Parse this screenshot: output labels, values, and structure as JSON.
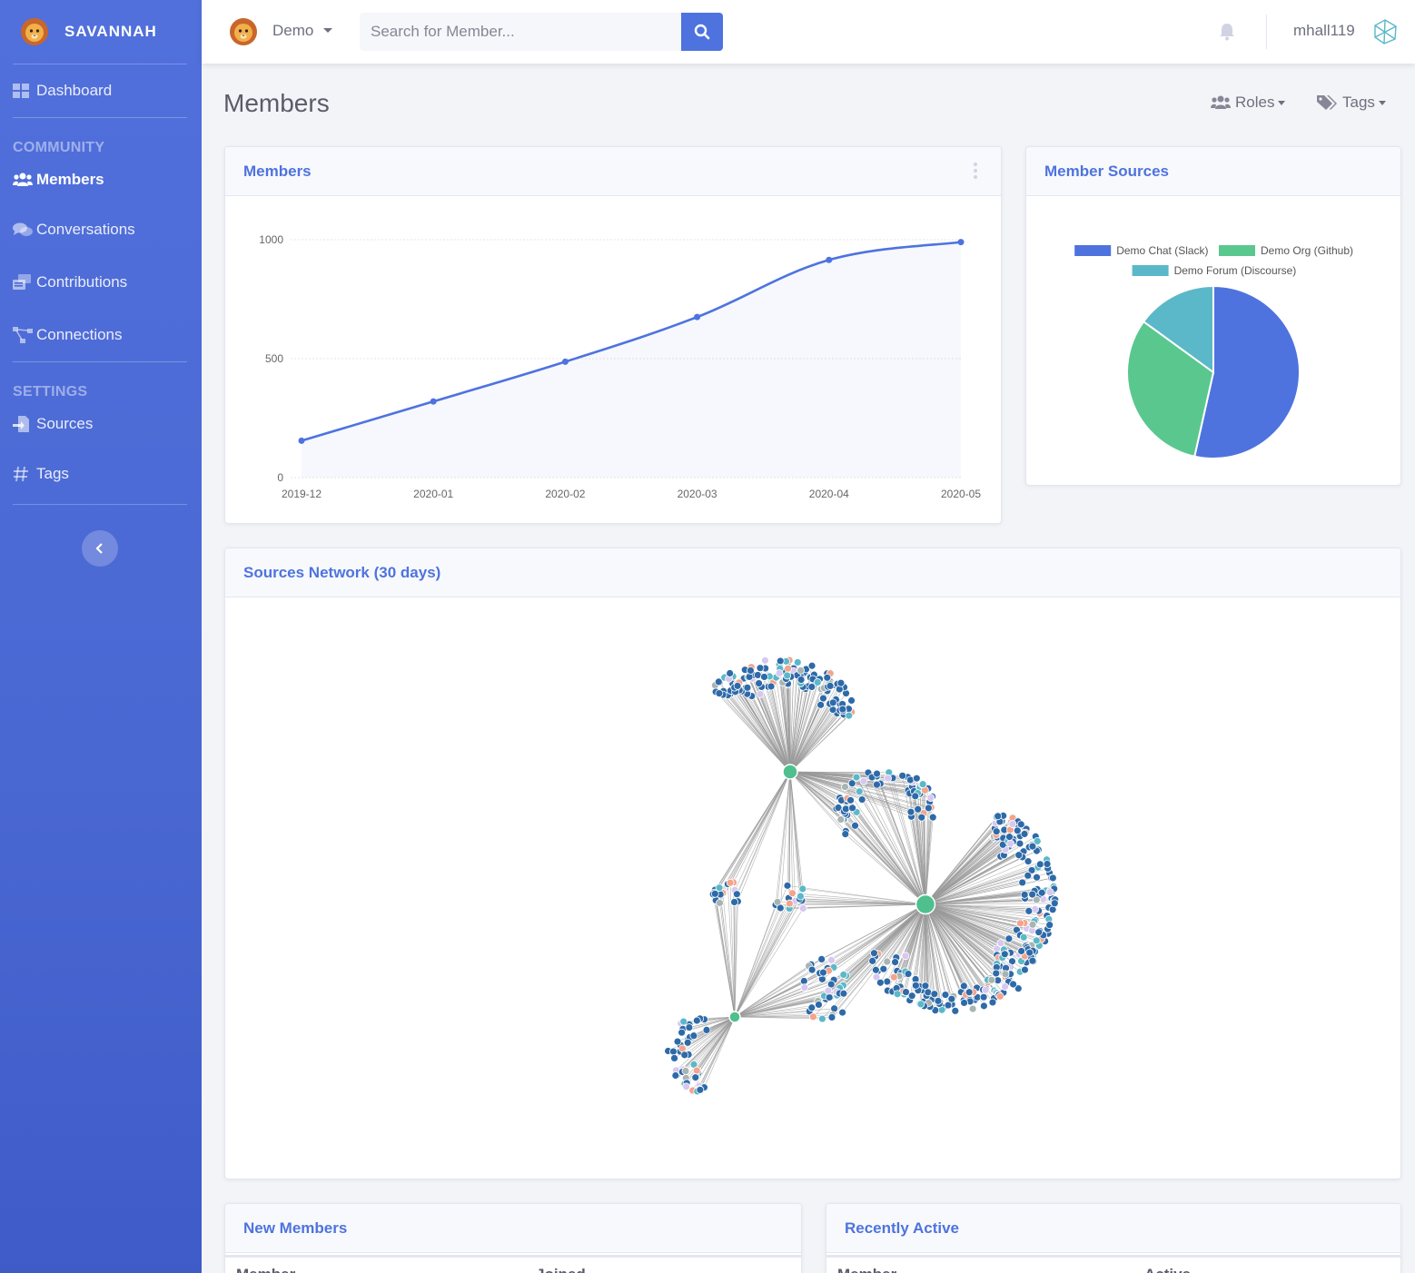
{
  "brand": {
    "name": "SAVANNAH"
  },
  "sidebar": {
    "items": [
      {
        "label": "Dashboard",
        "icon": "dashboard-icon"
      },
      {
        "heading": "COMMUNITY"
      },
      {
        "label": "Members",
        "icon": "users-icon",
        "active": true
      },
      {
        "label": "Conversations",
        "icon": "comments-icon"
      },
      {
        "label": "Contributions",
        "icon": "contributions-icon"
      },
      {
        "label": "Connections",
        "icon": "connections-icon"
      },
      {
        "heading": "SETTINGS"
      },
      {
        "label": "Sources",
        "icon": "sources-icon"
      },
      {
        "label": "Tags",
        "icon": "hash-icon"
      }
    ]
  },
  "topbar": {
    "org": "Demo",
    "search_placeholder": "Search for Member...",
    "username": "mhall119"
  },
  "page": {
    "title": "Members",
    "roles_label": "Roles",
    "tags_label": "Tags"
  },
  "members_card": {
    "title": "Members",
    "chart_data": {
      "type": "line",
      "x": [
        "2019-12",
        "2020-01",
        "2020-02",
        "2020-03",
        "2020-04",
        "2020-05"
      ],
      "series": [
        {
          "values": [
            155,
            320,
            487,
            675,
            915,
            990
          ]
        }
      ],
      "ylim": [
        0,
        1000
      ],
      "yticks": [
        0,
        500,
        1000
      ],
      "color": "#4e73df",
      "grid": true
    }
  },
  "sources_card": {
    "title": "Member Sources",
    "chart_data": {
      "type": "pie",
      "categories": [
        "Demo Chat (Slack)",
        "Demo Org (Github)",
        "Demo Forum (Discourse)"
      ],
      "values": [
        53.5,
        31.5,
        15
      ],
      "colors": [
        "#4e73df",
        "#5ac88e",
        "#5bb8c8"
      ],
      "legend": "top"
    }
  },
  "network_card": {
    "title": "Sources Network (30 days)"
  },
  "new_members_card": {
    "title": "New Members",
    "col1": "Member",
    "col2": "Joined"
  },
  "recent_card": {
    "title": "Recently Active",
    "col1": "Member",
    "col2": "Active"
  }
}
